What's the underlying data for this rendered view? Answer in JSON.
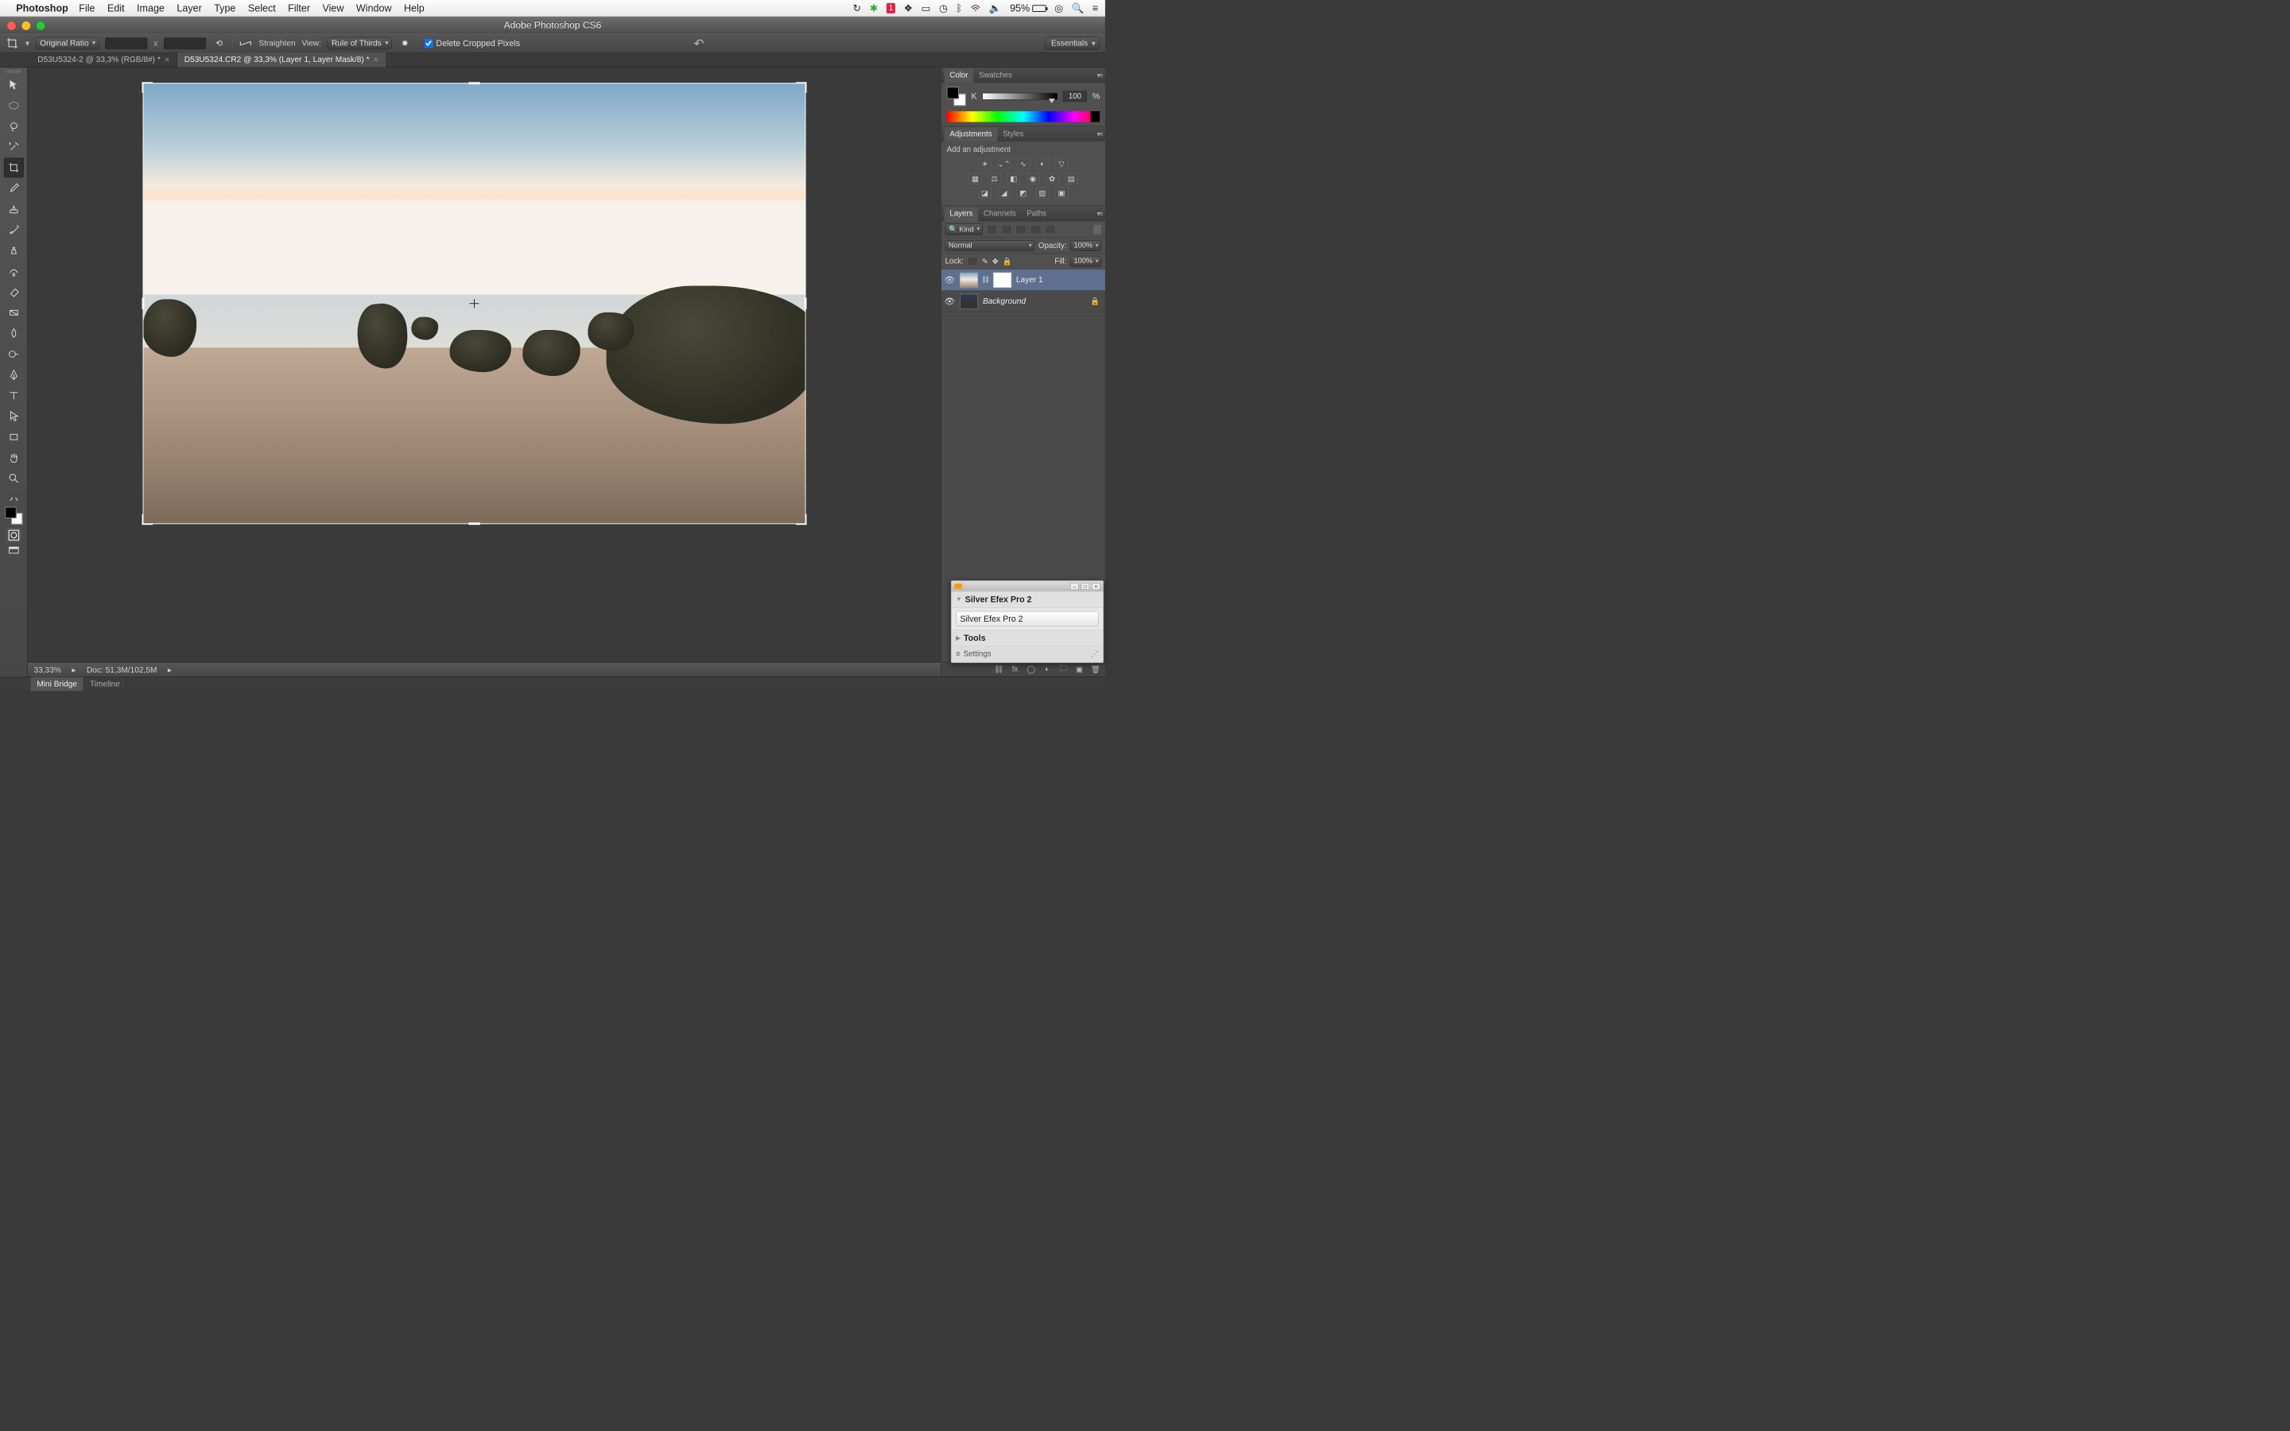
{
  "mac_menu": {
    "app": "Photoshop",
    "items": [
      "File",
      "Edit",
      "Image",
      "Layer",
      "Type",
      "Select",
      "Filter",
      "View",
      "Window",
      "Help"
    ],
    "battery_pct": "95%"
  },
  "window": {
    "title": "Adobe Photoshop CS6"
  },
  "options_bar": {
    "ratio": "Original Ratio",
    "straighten": "Straighten",
    "view_label": "View:",
    "view_value": "Rule of Thirds",
    "delete_cropped": "Delete Cropped Pixels",
    "workspace": "Essentials"
  },
  "doc_tabs": [
    {
      "label": "D53U5324-2 @ 33,3% (RGB/8#) *",
      "active": false
    },
    {
      "label": "D53U5324.CR2 @ 33,3% (Layer 1, Layer Mask/8) *",
      "active": true
    }
  ],
  "panels": {
    "color": {
      "tabs": [
        "Color",
        "Swatches"
      ],
      "k_label": "K",
      "k_value": "100",
      "pct": "%"
    },
    "adjustments": {
      "tabs": [
        "Adjustments",
        "Styles"
      ],
      "add_label": "Add an adjustment"
    },
    "layers": {
      "tabs": [
        "Layers",
        "Channels",
        "Paths"
      ],
      "kind": "Kind",
      "blend": "Normal",
      "opacity_label": "Opacity:",
      "opacity_value": "100%",
      "lock_label": "Lock:",
      "fill_label": "Fill:",
      "fill_value": "100%",
      "items": [
        {
          "name": "Layer 1",
          "mask": true
        },
        {
          "name": "Background",
          "locked": true
        }
      ]
    }
  },
  "float_panel": {
    "title": "Silver Efex Pro 2",
    "button": "Silver Efex Pro 2",
    "tools": "Tools",
    "settings": "Settings"
  },
  "status": {
    "zoom": "33,33%",
    "doc": "Doc: 51,3M/102,5M"
  },
  "bottom_tabs": [
    "Mini Bridge",
    "Timeline"
  ]
}
